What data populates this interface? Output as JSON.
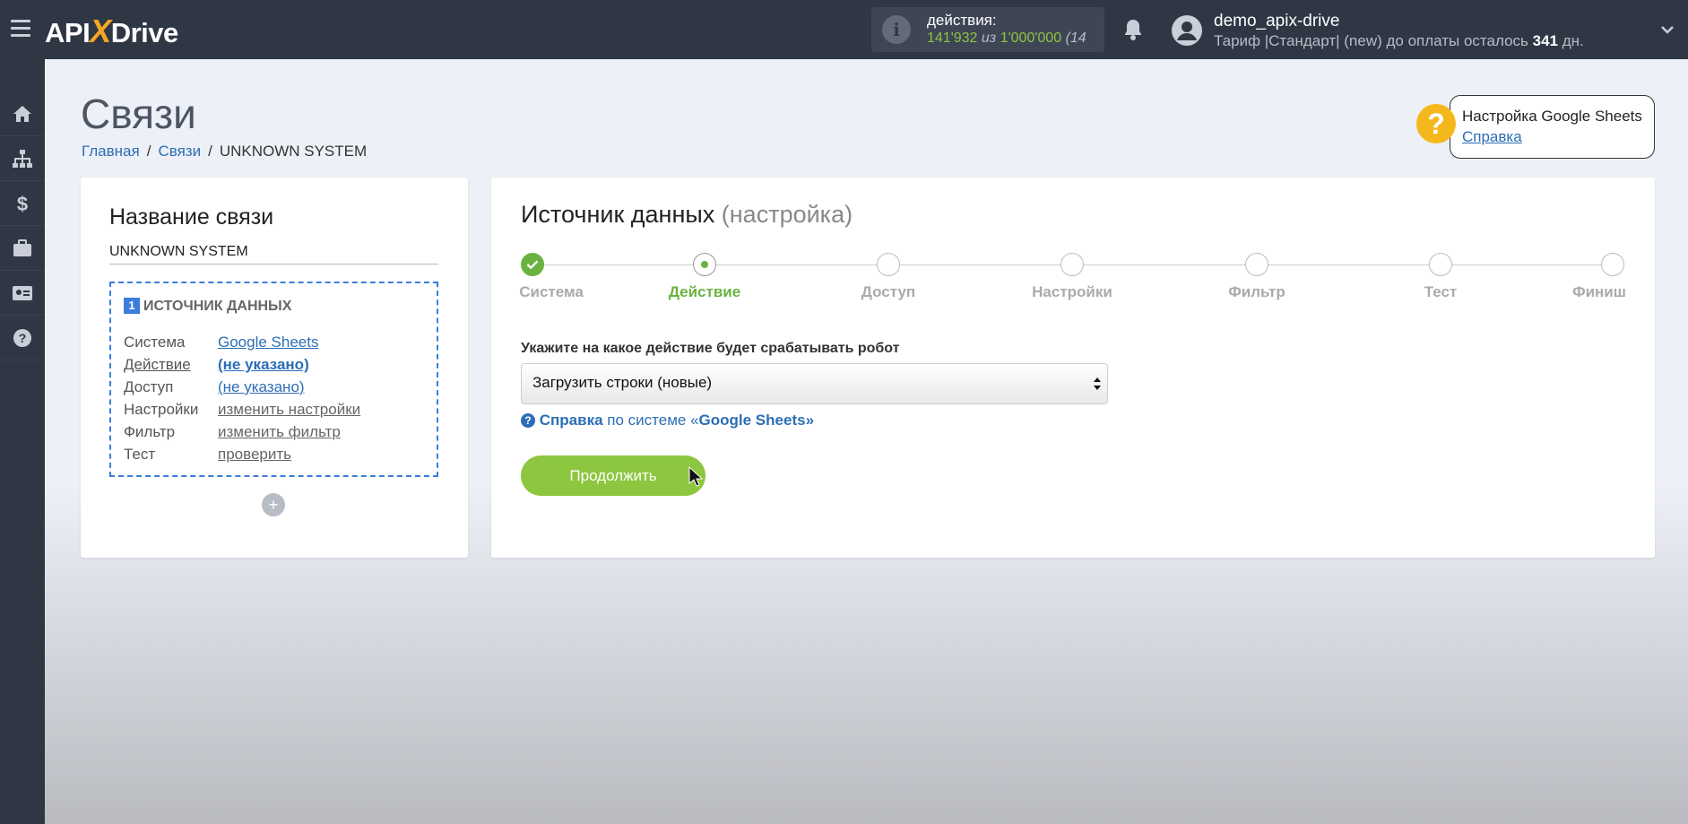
{
  "header": {
    "logo_left": "API",
    "logo_x": "X",
    "logo_right": "Drive",
    "actions_label": "действия:",
    "actions_used": "141'932",
    "actions_of": "из",
    "actions_total": "1'000'000",
    "actions_extra": "(14",
    "user_name": "demo_apix-drive",
    "plan_prefix": "Тариф |Стандарт| (new) до оплаты осталось",
    "plan_days": "341",
    "plan_suffix": "дн."
  },
  "sidebar": {
    "items": [
      "home-icon",
      "sitemap-icon",
      "dollar-icon",
      "briefcase-icon",
      "id-card-icon",
      "help-icon"
    ]
  },
  "page": {
    "title": "Связи",
    "breadcrumb": [
      "Главная",
      "Связи",
      "UNKNOWN SYSTEM"
    ],
    "help_title": "Настройка Google Sheets",
    "help_link": "Справка"
  },
  "left_panel": {
    "title": "Название связи",
    "connection_name": "UNKNOWN SYSTEM",
    "source_number": "1",
    "source_heading": "ИСТОЧНИК ДАННЫХ",
    "rows": [
      {
        "key": "Система",
        "value": "Google Sheets"
      },
      {
        "key": "Действие",
        "value": "(не указано)"
      },
      {
        "key": "Доступ",
        "value": "(не указано)"
      },
      {
        "key": "Настройки",
        "value": "изменить настройки"
      },
      {
        "key": "Фильтр",
        "value": "изменить фильтр"
      },
      {
        "key": "Тест",
        "value": "проверить"
      }
    ],
    "add_label": "+"
  },
  "right_panel": {
    "title": "Источник данных",
    "title_muted": "(настройка)",
    "steps": [
      "Система",
      "Действие",
      "Доступ",
      "Настройки",
      "Фильтр",
      "Тест",
      "Финиш"
    ],
    "prompt": "Укажите на какое действие будет срабатывать робот",
    "select_value": "Загрузить строки (новые)",
    "ref_link": "Справка",
    "ref_text": "по системе «",
    "ref_system": "Google Sheets",
    "ref_close": "»",
    "continue_label": "Продолжить"
  },
  "colors": {
    "topbar": "#2f3745",
    "accent_green": "#8dc63f",
    "link_blue": "#2c6eb5",
    "help_yellow": "#f5b81c"
  }
}
